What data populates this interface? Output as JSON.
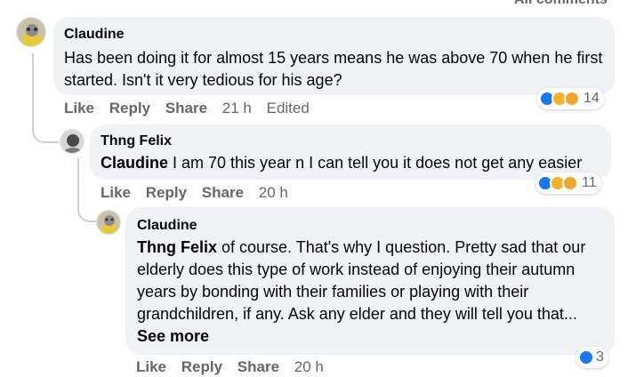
{
  "header": {
    "filter_label": "All comments"
  },
  "comments": [
    {
      "author": "Claudine",
      "text": "Has been doing it for almost 15 years means he was above 70 when he first started. Isn't it very tedious for his age?",
      "reaction_count": "14",
      "actions": {
        "like": "Like",
        "reply": "Reply",
        "share": "Share",
        "time": "21 h",
        "edited": "Edited"
      }
    },
    {
      "author": "Thng Felix",
      "mention": "Claudine",
      "text": " I am 70 this year n I can tell you it does not get any easier",
      "reaction_count": "11",
      "actions": {
        "like": "Like",
        "reply": "Reply",
        "share": "Share",
        "time": "20 h"
      }
    },
    {
      "author": "Claudine",
      "mention": "Thng Felix",
      "text": " of course. That's why I question. Pretty sad that our elderly does this type of work instead of enjoying their autumn years by bonding with their families or playing with their grandchildren, if any. Ask any elder and they will tell you that...",
      "see_more": "See more",
      "reaction_count": "3",
      "actions": {
        "like": "Like",
        "reply": "Reply",
        "share": "Share",
        "time": "20 h"
      }
    }
  ],
  "icons": {
    "like": "like-reaction-icon",
    "sad": "sad-reaction-icon",
    "care": "care-reaction-icon"
  },
  "colors": {
    "like_blue": "#1877f2",
    "bubble_bg": "#f0f2f5",
    "meta_gray": "#65676b"
  }
}
